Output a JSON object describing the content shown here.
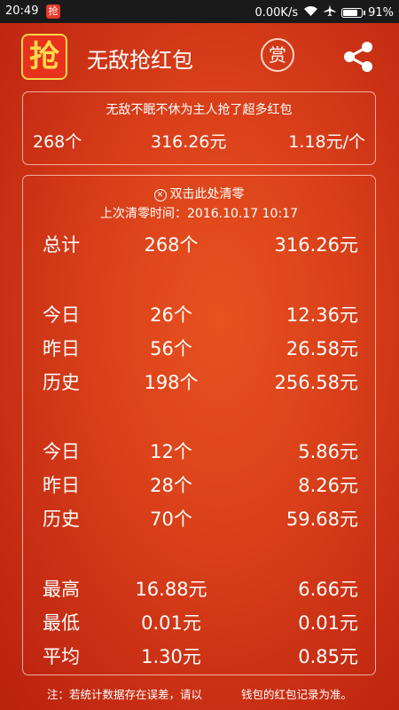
{
  "status_bar": {
    "time": "20:49",
    "notification_app_glyph": "抢",
    "network_speed": "0.00K/s",
    "battery_percent": "91%",
    "battery_level": 0.91,
    "icons": [
      "wifi-icon",
      "airplane-icon",
      "battery-icon"
    ]
  },
  "header": {
    "logo_glyph": "抢",
    "title": "无敌抢红包",
    "reward_glyph": "赏",
    "share_icon": "share-icon"
  },
  "summary": {
    "caption": "无敌不眠不休为主人抢了超多红包",
    "count": "268个",
    "amount": "316.26元",
    "average": "1.18元/个"
  },
  "stats": {
    "reset_label": "双击此处清零",
    "last_reset_label": "上次清零时间：",
    "last_reset_time": "2016.10.17 10:17",
    "total": {
      "label": "总计",
      "count": "268个",
      "amount": "316.26元"
    },
    "group1": [
      {
        "label": "今日",
        "count": "26个",
        "amount": "12.36元"
      },
      {
        "label": "昨日",
        "count": "56个",
        "amount": "26.58元"
      },
      {
        "label": "历史",
        "count": "198个",
        "amount": "256.58元"
      }
    ],
    "group2": [
      {
        "label": "今日",
        "count": "12个",
        "amount": "5.86元"
      },
      {
        "label": "昨日",
        "count": "28个",
        "amount": "8.26元"
      },
      {
        "label": "历史",
        "count": "70个",
        "amount": "59.68元"
      }
    ],
    "group3": [
      {
        "label": "最高",
        "col2": "16.88元",
        "col3": "6.66元"
      },
      {
        "label": "最低",
        "col2": "0.01元",
        "col3": "0.01元"
      },
      {
        "label": "平均",
        "col2": "1.30元",
        "col3": "0.85元"
      }
    ]
  },
  "footnote": {
    "part1": "注：若统计数据存在误差，请以",
    "part2": "钱包的红包记录为准。"
  },
  "colors": {
    "background": "#d9401a",
    "logo_bg": "#e8321e",
    "logo_glyph": "#ffd94a",
    "card_border": "#fbd6c8"
  }
}
